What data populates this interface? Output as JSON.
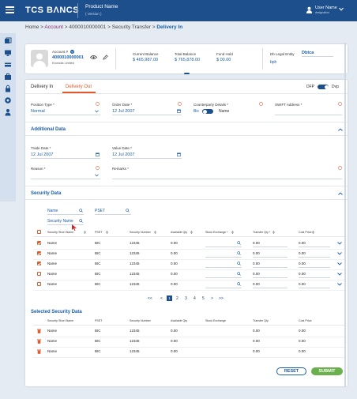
{
  "header": {
    "brand": "TCS BΛNCS",
    "product_name": "Product Name",
    "product_version": "( Version )",
    "user_name": "User Name",
    "user_role": "designation"
  },
  "breadcrumb": {
    "home": "Home",
    "sep1": " > ",
    "account": "Account",
    "sep2": " > ",
    "account_no": "4000010000001",
    "sep3": " > ",
    "transfer": "Security Transfer",
    "sep4": " > ",
    "current": "Delivery In"
  },
  "account_card": {
    "label": "Account #",
    "number": "4000010000001",
    "holder": "Kronicks Limited",
    "stats": [
      {
        "label": "Current Balance",
        "value": "$ 465,987.00"
      },
      {
        "label": "Total Balance",
        "value": "$ 765,878.00"
      },
      {
        "label": "Fund Hold",
        "value": "$ 00.00"
      }
    ],
    "legal_entity_label": "Db Legal Entity",
    "legal_entity_value": "Dbtca",
    "bph": "bph"
  },
  "tabs": [
    "Delivery In",
    "Delivery Out"
  ],
  "active_tab": "Delivery Out",
  "toggle": {
    "left": "DFP",
    "right": "Dvp"
  },
  "form": {
    "position_type": {
      "label": "Position Type *",
      "value": "Normal"
    },
    "order_date": {
      "label": "Order Date *",
      "value": "12 Jul 2007"
    },
    "counterparty": {
      "label": "Counterparty Details *",
      "left": "Bic",
      "right": "Name"
    },
    "swift": {
      "label": "SWIFT Address *",
      "value": ""
    }
  },
  "additional": {
    "title": "Additional Data",
    "trade_date": {
      "label": "Trade Date *",
      "value": "12 Jul 2007"
    },
    "value_date": {
      "label": "Value Date *",
      "value": "12 Jul 2007"
    },
    "reason": {
      "label": "Reason *",
      "value": ""
    },
    "remarks": {
      "label": "Remarks *",
      "value": ""
    }
  },
  "security": {
    "title": "Security Data",
    "filter1": "Name",
    "filter2": "PSET",
    "filter3": "Security Name",
    "columns": [
      "Security Short Name",
      "PSET",
      "Security Number",
      "Available Qty",
      "Stock Exchange *",
      "Transfer Qty *",
      "Cost Price"
    ],
    "rows": [
      {
        "name": "Name",
        "pset": "BIC",
        "number": "12345",
        "qty": "0.00",
        "tqty": "0.00",
        "cost": "0.00",
        "checked": true
      },
      {
        "name": "Name",
        "pset": "BIC",
        "number": "12345",
        "qty": "0.00",
        "tqty": "0.00",
        "cost": "0.00",
        "checked": true
      },
      {
        "name": "Name",
        "pset": "BIC",
        "number": "12345",
        "qty": "0.00",
        "tqty": "0.00",
        "cost": "0.00",
        "checked": true
      },
      {
        "name": "Name",
        "pset": "BIC",
        "number": "12345",
        "qty": "0.00",
        "tqty": "0.00",
        "cost": "0.00",
        "checked": false
      },
      {
        "name": "Name",
        "pset": "BIC",
        "number": "12345",
        "qty": "0.00",
        "tqty": "0.00",
        "cost": "0.00",
        "checked": false
      }
    ],
    "pager": {
      "first": "<<",
      "prev": "<",
      "pages": [
        "1",
        "2",
        "3",
        "4",
        "5"
      ],
      "next": ">",
      "last": ">>",
      "current": "1"
    }
  },
  "selected": {
    "title": "Selected Security Data",
    "columns": [
      "Security Short Name",
      "PSET",
      "Security Number",
      "Available Qty",
      "Stock Exchange",
      "Transfer Qty",
      "Cost Price"
    ],
    "rows": [
      {
        "name": "Name",
        "pset": "BIC",
        "number": "12345",
        "qty": "0.00",
        "tqty": "0.00",
        "cost": "0.00"
      },
      {
        "name": "Name",
        "pset": "BIC",
        "number": "12345",
        "qty": "0.00",
        "tqty": "0.00",
        "cost": "0.00"
      },
      {
        "name": "Name",
        "pset": "BIC",
        "number": "12345",
        "qty": "0.00",
        "tqty": "0.00",
        "cost": "0.00"
      }
    ]
  },
  "actions": {
    "reset": "RESET",
    "submit": "SUBMIT"
  },
  "colors": {
    "header": "#1d4f8c",
    "accent": "#1b5ea6",
    "orange": "#e05a2b",
    "submit": "#6ab04c"
  }
}
